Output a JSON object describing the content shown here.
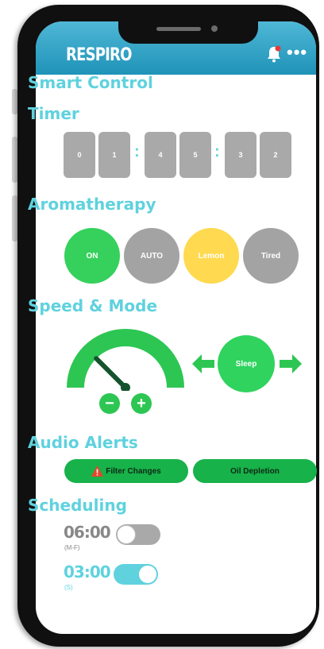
{
  "app": {
    "brand": "RESPIRO",
    "more_glyph": "•••",
    "colors": {
      "header": "#2a9fc4",
      "accent": "#5fd2de",
      "green": "#2dc653",
      "gray": "#a9a9a9",
      "yellow": "#ffd94f"
    }
  },
  "header": {
    "bell_icon": "bell-icon",
    "more_icon": "more-icon"
  },
  "smart_control": {
    "title": "Smart Control"
  },
  "timer": {
    "title": "Timer",
    "digits": [
      "0",
      "1",
      "4",
      "5",
      "3",
      "2"
    ],
    "separator": ":"
  },
  "aromatherapy": {
    "title": "Aromatherapy",
    "options": [
      {
        "label": "ON",
        "color": "#35d15c"
      },
      {
        "label": "AUTO",
        "color": "#a3a3a3"
      },
      {
        "label": "Lemon",
        "color": "#ffd94f"
      },
      {
        "label": "Tired",
        "color": "#a3a3a3"
      }
    ]
  },
  "speed_mode": {
    "title": "Speed & Mode",
    "minus": "−",
    "plus": "+",
    "mode": "Sleep",
    "speed_level": 0.25
  },
  "audio_alerts": {
    "title": "Audio Alerts",
    "items": [
      "Filter Changes",
      "Oil Depletion"
    ]
  },
  "scheduling": {
    "title": "Scheduling",
    "entries": [
      {
        "time": "06:00",
        "days": "(M-F)",
        "enabled": false
      },
      {
        "time": "03:00",
        "days": "(S)",
        "enabled": true
      }
    ]
  }
}
